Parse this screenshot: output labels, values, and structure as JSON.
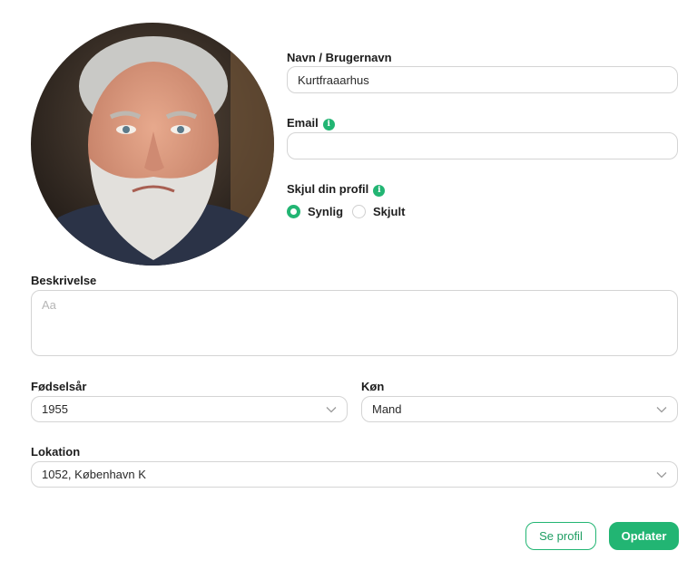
{
  "avatar": {
    "alt": "profile-photo"
  },
  "name_field": {
    "label": "Navn / Brugernavn",
    "value": "Kurtfraaarhus"
  },
  "email_field": {
    "label": "Email",
    "value": ""
  },
  "visibility": {
    "label": "Skjul din profil",
    "options": [
      {
        "label": "Synlig",
        "checked": true
      },
      {
        "label": "Skjult",
        "checked": false
      }
    ]
  },
  "description": {
    "label": "Beskrivelse",
    "placeholder": "Aa",
    "value": ""
  },
  "birth_year": {
    "label": "Fødselsår",
    "value": "1955"
  },
  "gender": {
    "label": "Køn",
    "value": "Mand"
  },
  "location": {
    "label": "Lokation",
    "value": "1052, København K"
  },
  "buttons": {
    "view_profile": "Se profil",
    "update": "Opdater"
  },
  "colors": {
    "accent": "#22b573",
    "border": "#d4d4d4"
  }
}
